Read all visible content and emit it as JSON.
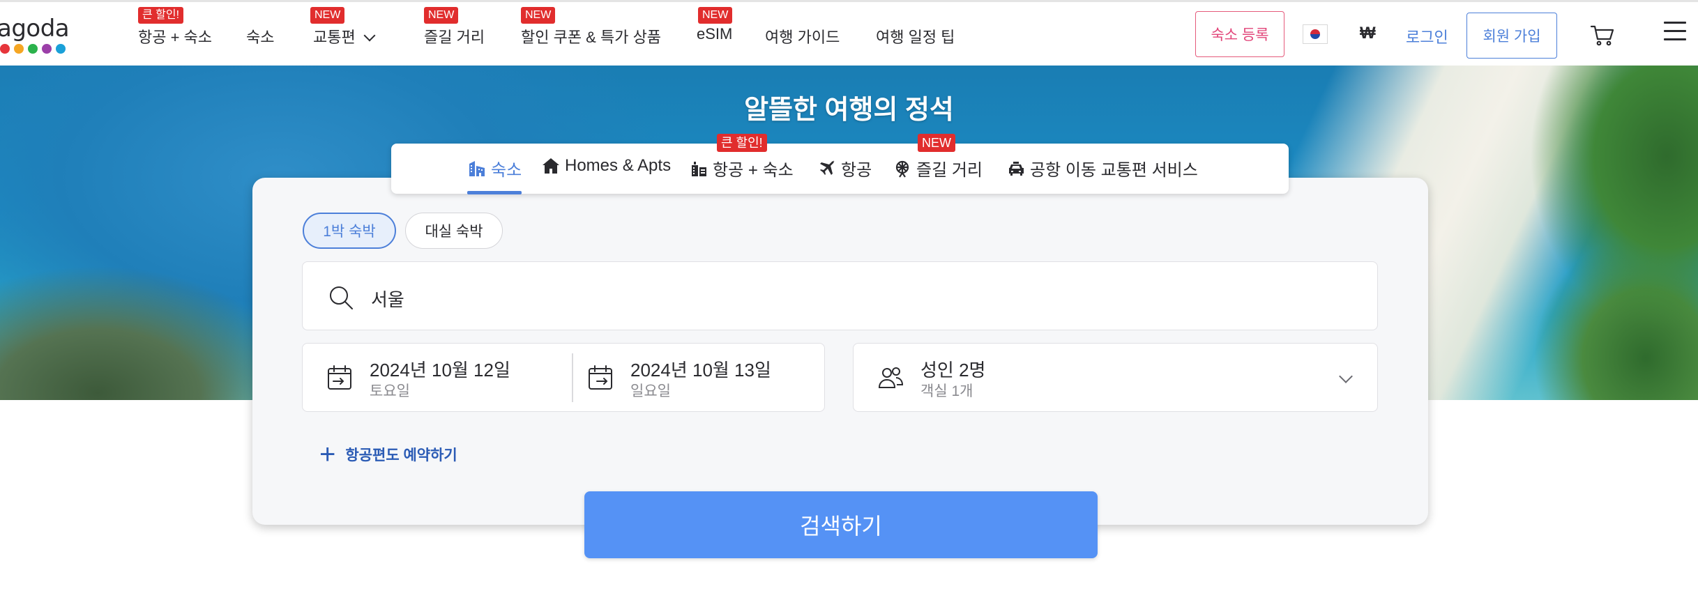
{
  "brand": {
    "logo_text": "agoda",
    "dot_colors": [
      "#e6353b",
      "#f5a623",
      "#2bb24c",
      "#9b3fa8",
      "#1aa0d8"
    ]
  },
  "nav": {
    "items": [
      {
        "label": "항공 + 숙소",
        "badge": "큰 할인!"
      },
      {
        "label": "숙소",
        "badge": ""
      },
      {
        "label": "교통편",
        "badge": "NEW"
      },
      {
        "label": "즐길 거리",
        "badge": "NEW"
      },
      {
        "label": "할인 쿠폰 & 특가 상품",
        "badge": "NEW"
      },
      {
        "label": "eSIM",
        "badge": "NEW"
      },
      {
        "label": "여행 가이드",
        "badge": ""
      },
      {
        "label": "여행 일정 팁",
        "badge": ""
      }
    ],
    "register_property": "숙소 등록",
    "currency": "₩",
    "login": "로그인",
    "signup": "회원 가입"
  },
  "hero": {
    "title": "알뜰한 여행의 정석"
  },
  "tabs": [
    {
      "label": "숙소",
      "icon": "building-icon",
      "badge": "",
      "active": true
    },
    {
      "label": "Homes & Apts",
      "icon": "house-icon",
      "badge": "",
      "active": false
    },
    {
      "label": "항공 + 숙소",
      "icon": "hotel-luggage-icon",
      "badge": "큰 할인!",
      "active": false
    },
    {
      "label": "항공",
      "icon": "airplane-icon",
      "badge": "",
      "active": false
    },
    {
      "label": "즐길 거리",
      "icon": "ferris-wheel-icon",
      "badge": "NEW",
      "active": false
    },
    {
      "label": "공항 이동 교통편 서비스",
      "icon": "car-icon",
      "badge": "",
      "active": false
    }
  ],
  "search": {
    "stay_types": [
      "1박 숙박",
      "대실 숙박"
    ],
    "destination": "서울",
    "checkin": {
      "date": "2024년 10월 12일",
      "weekday": "토요일"
    },
    "checkout": {
      "date": "2024년 10월 13일",
      "weekday": "일요일"
    },
    "guests": {
      "main": "성인 2명",
      "sub": "객실 1개"
    },
    "add_flight": "항공편도 예약하기",
    "submit": "검색하기"
  },
  "colors": {
    "accent_blue": "#4c7fd9",
    "search_button": "#5592f5",
    "badge_red": "#e12d2d",
    "register_pink": "#e2467a"
  }
}
